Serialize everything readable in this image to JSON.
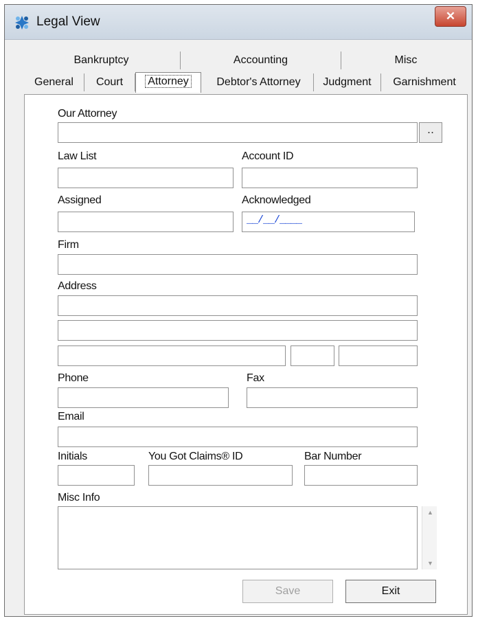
{
  "window": {
    "title": "Legal View",
    "close_symbol": "✕"
  },
  "tabs": {
    "row1": [
      "Bankruptcy",
      "Accounting",
      "Misc"
    ],
    "row2": [
      "General",
      "Court",
      "Attorney",
      "Debtor's Attorney",
      "Judgment",
      "Garnishment"
    ],
    "active": "Attorney"
  },
  "form": {
    "our_attorney": {
      "label": "Our Attorney",
      "value": ""
    },
    "browse_label": "․․",
    "law_list": {
      "label": "Law List",
      "value": ""
    },
    "account_id": {
      "label": "Account ID",
      "value": ""
    },
    "assigned": {
      "label": "Assigned",
      "value": ""
    },
    "acknowledged": {
      "label": "Acknowledged",
      "value": "__/__/____"
    },
    "firm": {
      "label": "Firm",
      "value": ""
    },
    "address": {
      "label": "Address",
      "line1": "",
      "line2": "",
      "city": "",
      "state": "",
      "zip": ""
    },
    "phone": {
      "label": "Phone",
      "value": ""
    },
    "fax": {
      "label": "Fax",
      "value": ""
    },
    "email": {
      "label": "Email",
      "value": ""
    },
    "initials": {
      "label": "Initials",
      "value": ""
    },
    "ygc_id": {
      "label": "You Got Claims® ID",
      "value": ""
    },
    "bar_number": {
      "label": "Bar Number",
      "value": ""
    },
    "misc_info": {
      "label": "Misc Info",
      "value": ""
    }
  },
  "buttons": {
    "save": "Save",
    "exit": "Exit"
  }
}
